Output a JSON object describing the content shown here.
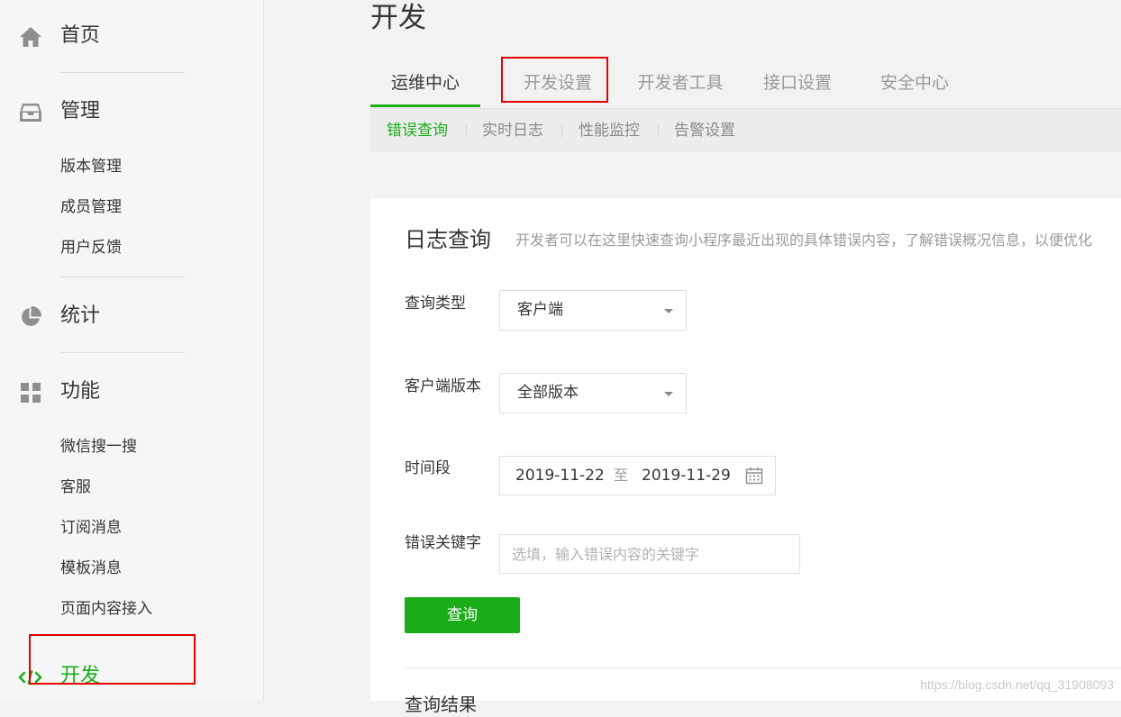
{
  "sidebar": {
    "home": {
      "label": "首页",
      "icon": "home-icon"
    },
    "manage": {
      "label": "管理",
      "icon": "inbox-icon",
      "items": [
        "版本管理",
        "成员管理",
        "用户反馈"
      ]
    },
    "stats": {
      "label": "统计",
      "icon": "pie-chart-icon"
    },
    "features": {
      "label": "功能",
      "icon": "grid-icon",
      "items": [
        "微信搜一搜",
        "客服",
        "订阅消息",
        "模板消息",
        "页面内容接入"
      ]
    },
    "develop": {
      "label": "开发",
      "icon": "code-icon"
    }
  },
  "main": {
    "title": "开发",
    "tabs": [
      "运维中心",
      "开发设置",
      "开发者工具",
      "接口设置",
      "安全中心"
    ],
    "subtabs": [
      "错误查询",
      "实时日志",
      "性能监控",
      "告警设置"
    ],
    "card": {
      "title": "日志查询",
      "description": "开发者可以在这里快速查询小程序最近出现的具体错误内容，了解错误概况信息，以便优化",
      "fields": {
        "query_type": {
          "label": "查询类型",
          "value": "客户端"
        },
        "client_version": {
          "label": "客户端版本",
          "value": "全部版本"
        },
        "time_range": {
          "label": "时间段",
          "start": "2019-11-22",
          "separator": "至",
          "end": "2019-11-29"
        },
        "keyword": {
          "label": "错误关键字",
          "placeholder": "选填，输入错误内容的关键字"
        }
      },
      "query_button": "查询",
      "results_title": "查询结果"
    }
  },
  "watermark": "https://blog.csdn.net/qq_31908093",
  "colors": {
    "accent": "#1aad19",
    "highlight_box": "#e50000"
  }
}
